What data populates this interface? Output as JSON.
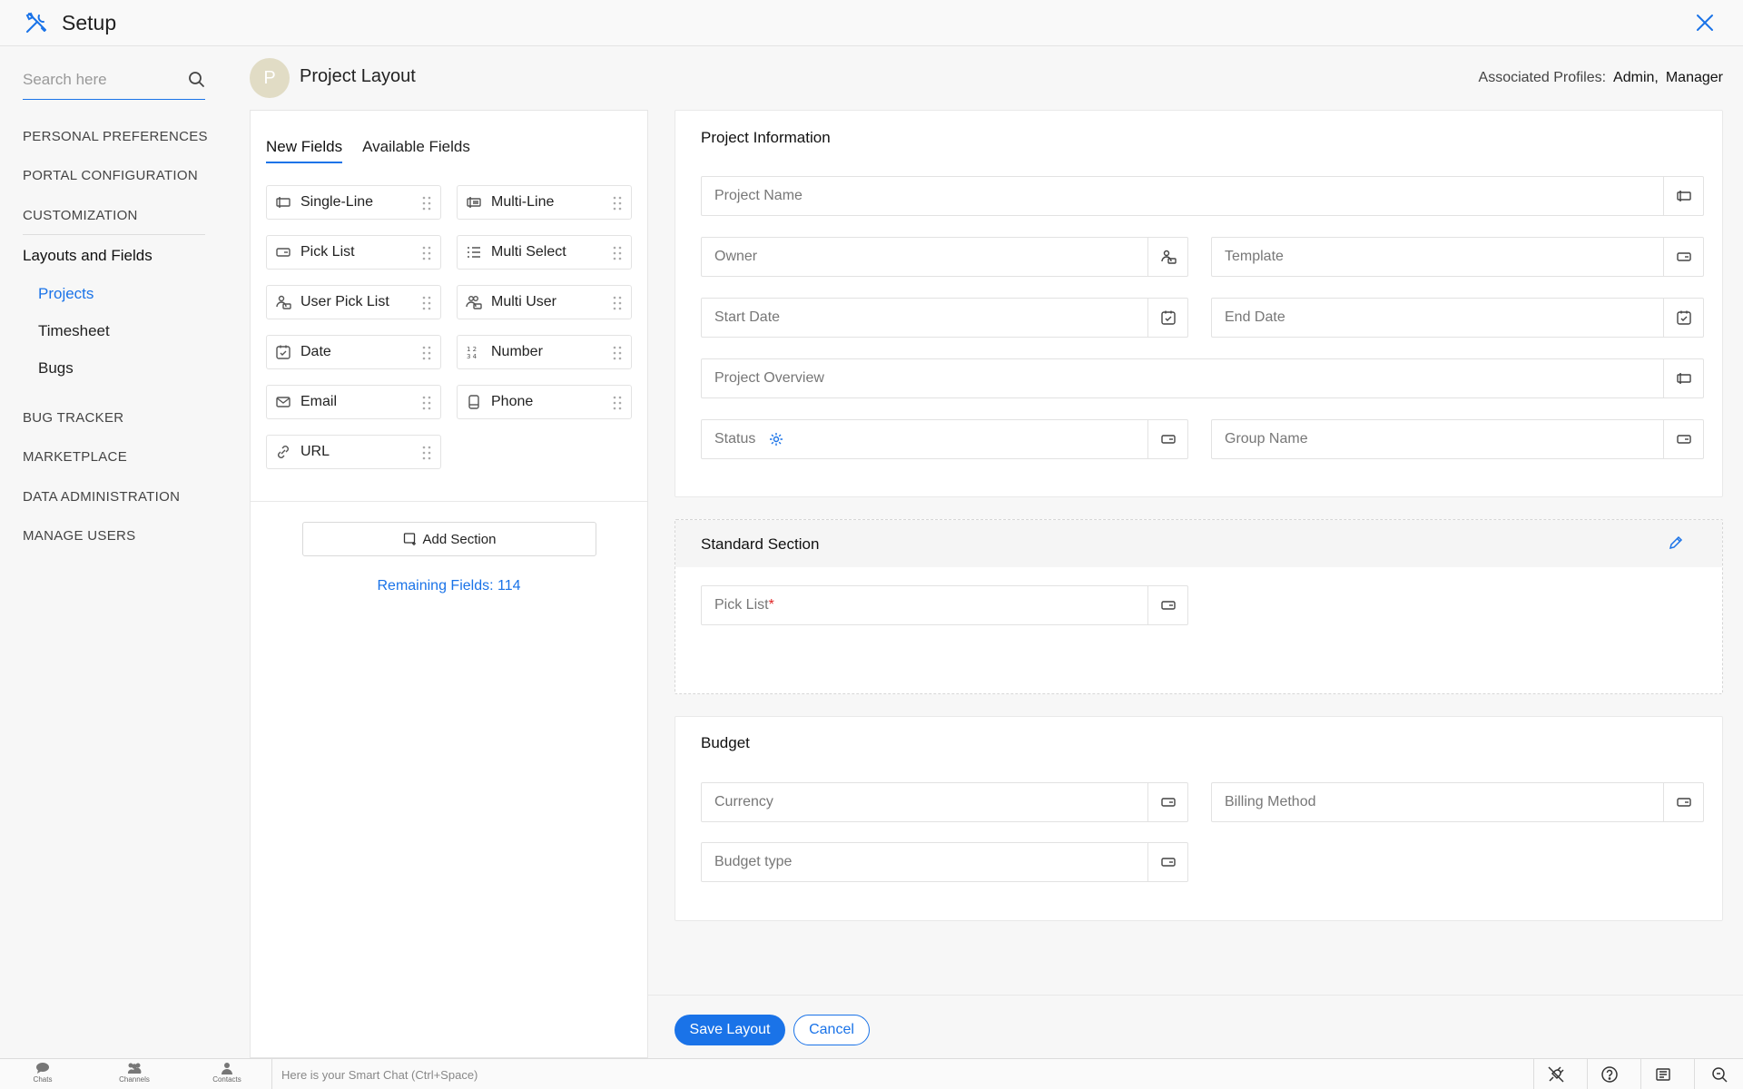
{
  "header": {
    "title": "Setup"
  },
  "sidebar": {
    "search_placeholder": "Search here",
    "sections_top": [
      "PERSONAL PREFERENCES",
      "PORTAL CONFIGURATION",
      "CUSTOMIZATION"
    ],
    "group_title": "Layouts and Fields",
    "sub_items": [
      "Projects",
      "Timesheet",
      "Bugs"
    ],
    "active_sub": "Projects",
    "sections_bottom": [
      "BUG TRACKER",
      "MARKETPLACE",
      "DATA ADMINISTRATION",
      "MANAGE USERS"
    ]
  },
  "page": {
    "avatar_letter": "P",
    "title": "Project Layout",
    "assoc_label": "Associated Profiles:",
    "profiles": [
      "Admin,",
      "Manager"
    ]
  },
  "palette": {
    "tabs": [
      "New Fields",
      "Available Fields"
    ],
    "active_tab": "New Fields",
    "fields": [
      {
        "label": "Single-Line",
        "icon": "single-line-icon"
      },
      {
        "label": "Multi-Line",
        "icon": "multi-line-icon"
      },
      {
        "label": "Pick List",
        "icon": "pick-list-icon"
      },
      {
        "label": "Multi Select",
        "icon": "multi-select-icon"
      },
      {
        "label": "User Pick List",
        "icon": "user-pick-list-icon"
      },
      {
        "label": "Multi User",
        "icon": "multi-user-icon"
      },
      {
        "label": "Date",
        "icon": "date-icon"
      },
      {
        "label": "Number",
        "icon": "number-icon"
      },
      {
        "label": "Email",
        "icon": "email-icon"
      },
      {
        "label": "Phone",
        "icon": "phone-icon"
      },
      {
        "label": "URL",
        "icon": "url-icon"
      }
    ],
    "add_section_label": "Add Section",
    "remaining_fields": "Remaining Fields: 114"
  },
  "layout": {
    "sections": [
      {
        "title": "Project Information",
        "fields": [
          {
            "label": "Project Name",
            "icon": "single-line-icon"
          },
          {
            "label": "Owner",
            "icon": "user-pick-list-icon"
          },
          {
            "label": "Template",
            "icon": "pick-list-icon"
          },
          {
            "label": "Start Date",
            "icon": "date-icon"
          },
          {
            "label": "End Date",
            "icon": "date-icon"
          },
          {
            "label": "Project Overview",
            "icon": "single-line-icon"
          },
          {
            "label": "Status",
            "icon": "pick-list-icon"
          },
          {
            "label": "Group Name",
            "icon": "pick-list-icon"
          }
        ]
      },
      {
        "title": "Standard Section",
        "fields": [
          {
            "label": "Pick List",
            "required_mark": "*",
            "icon": "pick-list-icon"
          }
        ]
      },
      {
        "title": "Budget",
        "fields": [
          {
            "label": "Currency",
            "icon": "pick-list-icon"
          },
          {
            "label": "Billing Method",
            "icon": "pick-list-icon"
          },
          {
            "label": "Budget type",
            "icon": "pick-list-icon"
          }
        ]
      }
    ]
  },
  "actions": {
    "save_label": "Save Layout",
    "cancel_label": "Cancel"
  },
  "chatbar": {
    "items": [
      "Chats",
      "Channels",
      "Contacts"
    ],
    "placeholder": "Here is your Smart Chat (Ctrl+Space)"
  },
  "colors": {
    "accent": "#1a73e8",
    "required": "#e02424",
    "avatar_bg": "#e1dcc5"
  }
}
